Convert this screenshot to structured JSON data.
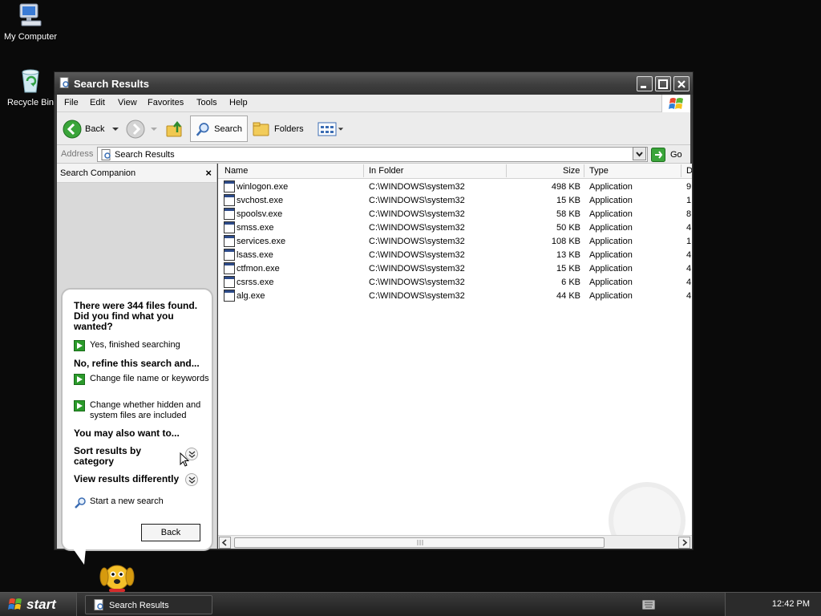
{
  "desktop": {
    "icons": [
      {
        "label": "My Computer"
      },
      {
        "label": "Recycle Bin"
      }
    ]
  },
  "window": {
    "title": "Search Results",
    "menu": [
      "File",
      "Edit",
      "View",
      "Favorites",
      "Tools",
      "Help"
    ],
    "toolbar": {
      "back_label": "Back",
      "search_label": "Search",
      "folders_label": "Folders"
    },
    "address": {
      "label": "Address",
      "value": "Search Results",
      "go_label": "Go"
    }
  },
  "companion": {
    "title": "Search Companion",
    "close_glyph": "×",
    "heading": "There were 344 files found. Did you find what you wanted?",
    "finished": "Yes, finished searching",
    "refine_heading": "No, refine this search and...",
    "refine_options": [
      "Change file name or keywords",
      "Change whether hidden and system files are included"
    ],
    "also_heading": "You may also want to...",
    "sort_label": "Sort results by category",
    "view_label": "View results differently",
    "new_search": "Start a new search",
    "back_button": "Back"
  },
  "files": {
    "columns": [
      "Name",
      "In Folder",
      "Size",
      "Type",
      "D"
    ],
    "rows": [
      {
        "name": "winlogon.exe",
        "folder": "C:\\WINDOWS\\system32",
        "size": "498 KB",
        "type": "Application",
        "date": "9"
      },
      {
        "name": "svchost.exe",
        "folder": "C:\\WINDOWS\\system32",
        "size": "15 KB",
        "type": "Application",
        "date": "1"
      },
      {
        "name": "spoolsv.exe",
        "folder": "C:\\WINDOWS\\system32",
        "size": "58 KB",
        "type": "Application",
        "date": "8"
      },
      {
        "name": "smss.exe",
        "folder": "C:\\WINDOWS\\system32",
        "size": "50 KB",
        "type": "Application",
        "date": "4"
      },
      {
        "name": "services.exe",
        "folder": "C:\\WINDOWS\\system32",
        "size": "108 KB",
        "type": "Application",
        "date": "1"
      },
      {
        "name": "lsass.exe",
        "folder": "C:\\WINDOWS\\system32",
        "size": "13 KB",
        "type": "Application",
        "date": "4"
      },
      {
        "name": "ctfmon.exe",
        "folder": "C:\\WINDOWS\\system32",
        "size": "15 KB",
        "type": "Application",
        "date": "4"
      },
      {
        "name": "csrss.exe",
        "folder": "C:\\WINDOWS\\system32",
        "size": "6 KB",
        "type": "Application",
        "date": "4"
      },
      {
        "name": "alg.exe",
        "folder": "C:\\WINDOWS\\system32",
        "size": "44 KB",
        "type": "Application",
        "date": "4"
      }
    ]
  },
  "taskbar": {
    "start_label": "start",
    "task_label": "Search Results",
    "clock": "12:42 PM"
  }
}
